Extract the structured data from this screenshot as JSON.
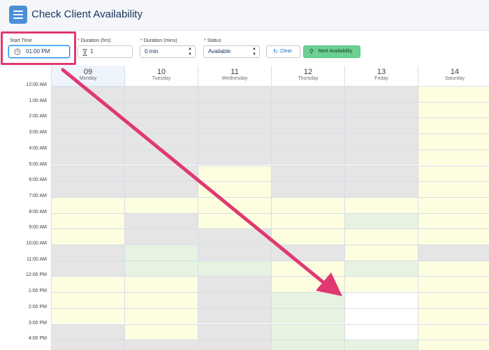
{
  "header": {
    "title": "Check Client Availability",
    "icon": "menu-icon"
  },
  "toolbar": {
    "start_time": {
      "label": "Start Time",
      "value": "01:00 PM",
      "icon": "clock-icon"
    },
    "duration_hrs": {
      "label": "Duration (hrs)",
      "value": "1",
      "icon": "hourglass-icon"
    },
    "duration_mins": {
      "label": "Duration (mins)",
      "value": "0 min"
    },
    "status": {
      "label": "Status",
      "value": "Available"
    },
    "clear_label": "Clear",
    "next_label": "Next Availability"
  },
  "calendar": {
    "days": [
      {
        "num": "09",
        "name": "Monday"
      },
      {
        "num": "10",
        "name": "Tuesday"
      },
      {
        "num": "11",
        "name": "Wednesday"
      },
      {
        "num": "12",
        "name": "Thursday"
      },
      {
        "num": "13",
        "name": "Friday"
      },
      {
        "num": "14",
        "name": "Saturday"
      }
    ],
    "times": [
      "12:00 AM",
      "1:00 AM",
      "2:00 AM",
      "3:00 AM",
      "4:00 AM",
      "5:00 AM",
      "6:00 AM",
      "7:00 AM",
      "8:00 AM",
      "9:00 AM",
      "10:00 AM",
      "11:00 AM",
      "12:00 PM",
      "1:00 PM",
      "2:00 PM",
      "3:00 PM",
      "4:00 PM"
    ],
    "legend_colors": {
      "G": "#e5e5e5",
      "Y": "#fdfde0",
      "L": "#e5f3e0",
      "W": "#ffffff"
    },
    "grid": [
      [
        "G",
        "G",
        "G",
        "G",
        "G",
        "Y"
      ],
      [
        "G",
        "G",
        "G",
        "G",
        "G",
        "Y"
      ],
      [
        "G",
        "G",
        "G",
        "G",
        "G",
        "Y"
      ],
      [
        "G",
        "G",
        "G",
        "G",
        "G",
        "Y"
      ],
      [
        "G",
        "G",
        "G",
        "G",
        "G",
        "Y"
      ],
      [
        "G",
        "G",
        "Y",
        "G",
        "G",
        "Y"
      ],
      [
        "G",
        "G",
        "Y",
        "G",
        "G",
        "Y"
      ],
      [
        "Y",
        "Y",
        "Y",
        "Y",
        "Y",
        "Y"
      ],
      [
        "Y",
        "G",
        "Y",
        "Y",
        "L",
        "Y"
      ],
      [
        "Y",
        "G",
        "G",
        "Y",
        "Y",
        "Y"
      ],
      [
        "G",
        "L",
        "G",
        "G",
        "Y",
        "G"
      ],
      [
        "G",
        "L",
        "L",
        "Y",
        "L",
        "Y"
      ],
      [
        "Y",
        "Y",
        "G",
        "Y",
        "Y",
        "Y"
      ],
      [
        "Y",
        "Y",
        "G",
        "L",
        "W",
        "Y"
      ],
      [
        "Y",
        "Y",
        "G",
        "L",
        "W",
        "Y"
      ],
      [
        "G",
        "Y",
        "G",
        "L",
        "W",
        "Y"
      ],
      [
        "G",
        "G",
        "G",
        "L",
        "L",
        "Y"
      ]
    ],
    "arrow_color": "#e03870"
  }
}
